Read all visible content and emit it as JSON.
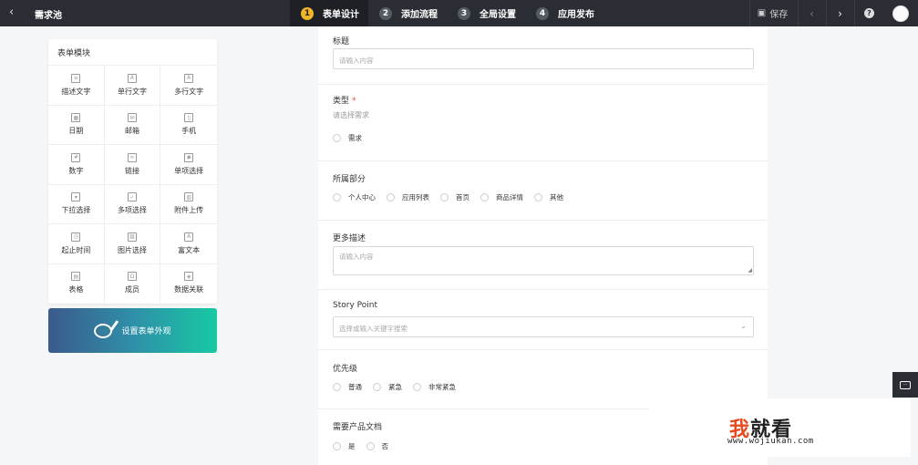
{
  "header": {
    "back_icon": "chevron-left-icon",
    "title": "需求池",
    "steps": [
      {
        "num": "1",
        "label": "表单设计"
      },
      {
        "num": "2",
        "label": "添加流程"
      },
      {
        "num": "3",
        "label": "全局设置"
      },
      {
        "num": "4",
        "label": "应用发布"
      }
    ],
    "save_label": "保存",
    "prev": "‹",
    "next": "›",
    "help": "?"
  },
  "modules": {
    "title": "表单模块",
    "items": [
      {
        "label": "描述文字",
        "icon": "paragraph-icon"
      },
      {
        "label": "单行文字",
        "icon": "text-icon"
      },
      {
        "label": "多行文字",
        "icon": "textarea-icon"
      },
      {
        "label": "日期",
        "icon": "calendar-icon"
      },
      {
        "label": "邮箱",
        "icon": "mail-icon"
      },
      {
        "label": "手机",
        "icon": "phone-icon"
      },
      {
        "label": "数字",
        "icon": "number-icon"
      },
      {
        "label": "链接",
        "icon": "link-icon"
      },
      {
        "label": "单项选择",
        "icon": "radio-icon"
      },
      {
        "label": "下拉选择",
        "icon": "dropdown-icon"
      },
      {
        "label": "多项选择",
        "icon": "checkbox-icon"
      },
      {
        "label": "附件上传",
        "icon": "attachment-icon"
      },
      {
        "label": "起止时间",
        "icon": "clock-icon"
      },
      {
        "label": "图片选择",
        "icon": "image-icon"
      },
      {
        "label": "富文本",
        "icon": "richtext-icon"
      },
      {
        "label": "表格",
        "icon": "table-icon"
      },
      {
        "label": "成员",
        "icon": "user-icon"
      },
      {
        "label": "数据关联",
        "icon": "relation-icon"
      }
    ],
    "appearance_label": "设置表单外观"
  },
  "form": {
    "title_field": {
      "label": "标题",
      "placeholder": "请输入内容"
    },
    "type_field": {
      "label": "类型",
      "required": "*",
      "hint": "请选择需求",
      "options": [
        "需求"
      ]
    },
    "dept_field": {
      "label": "所属部分",
      "options": [
        "个人中心",
        "应用列表",
        "首页",
        "商品详情",
        "其他"
      ]
    },
    "desc_field": {
      "label": "更多描述",
      "placeholder": "请输入内容"
    },
    "story_field": {
      "label": "Story Point",
      "placeholder": "选择或输入关键字搜索"
    },
    "priority_field": {
      "label": "优先级",
      "options": [
        "普通",
        "紧急",
        "非常紧急"
      ]
    },
    "doc_field": {
      "label": "需要产品文档",
      "options": [
        "是",
        "否"
      ]
    }
  },
  "watermark": {
    "big_first": "我",
    "big_rest": "就看",
    "url": "www.wojiukan.com"
  }
}
